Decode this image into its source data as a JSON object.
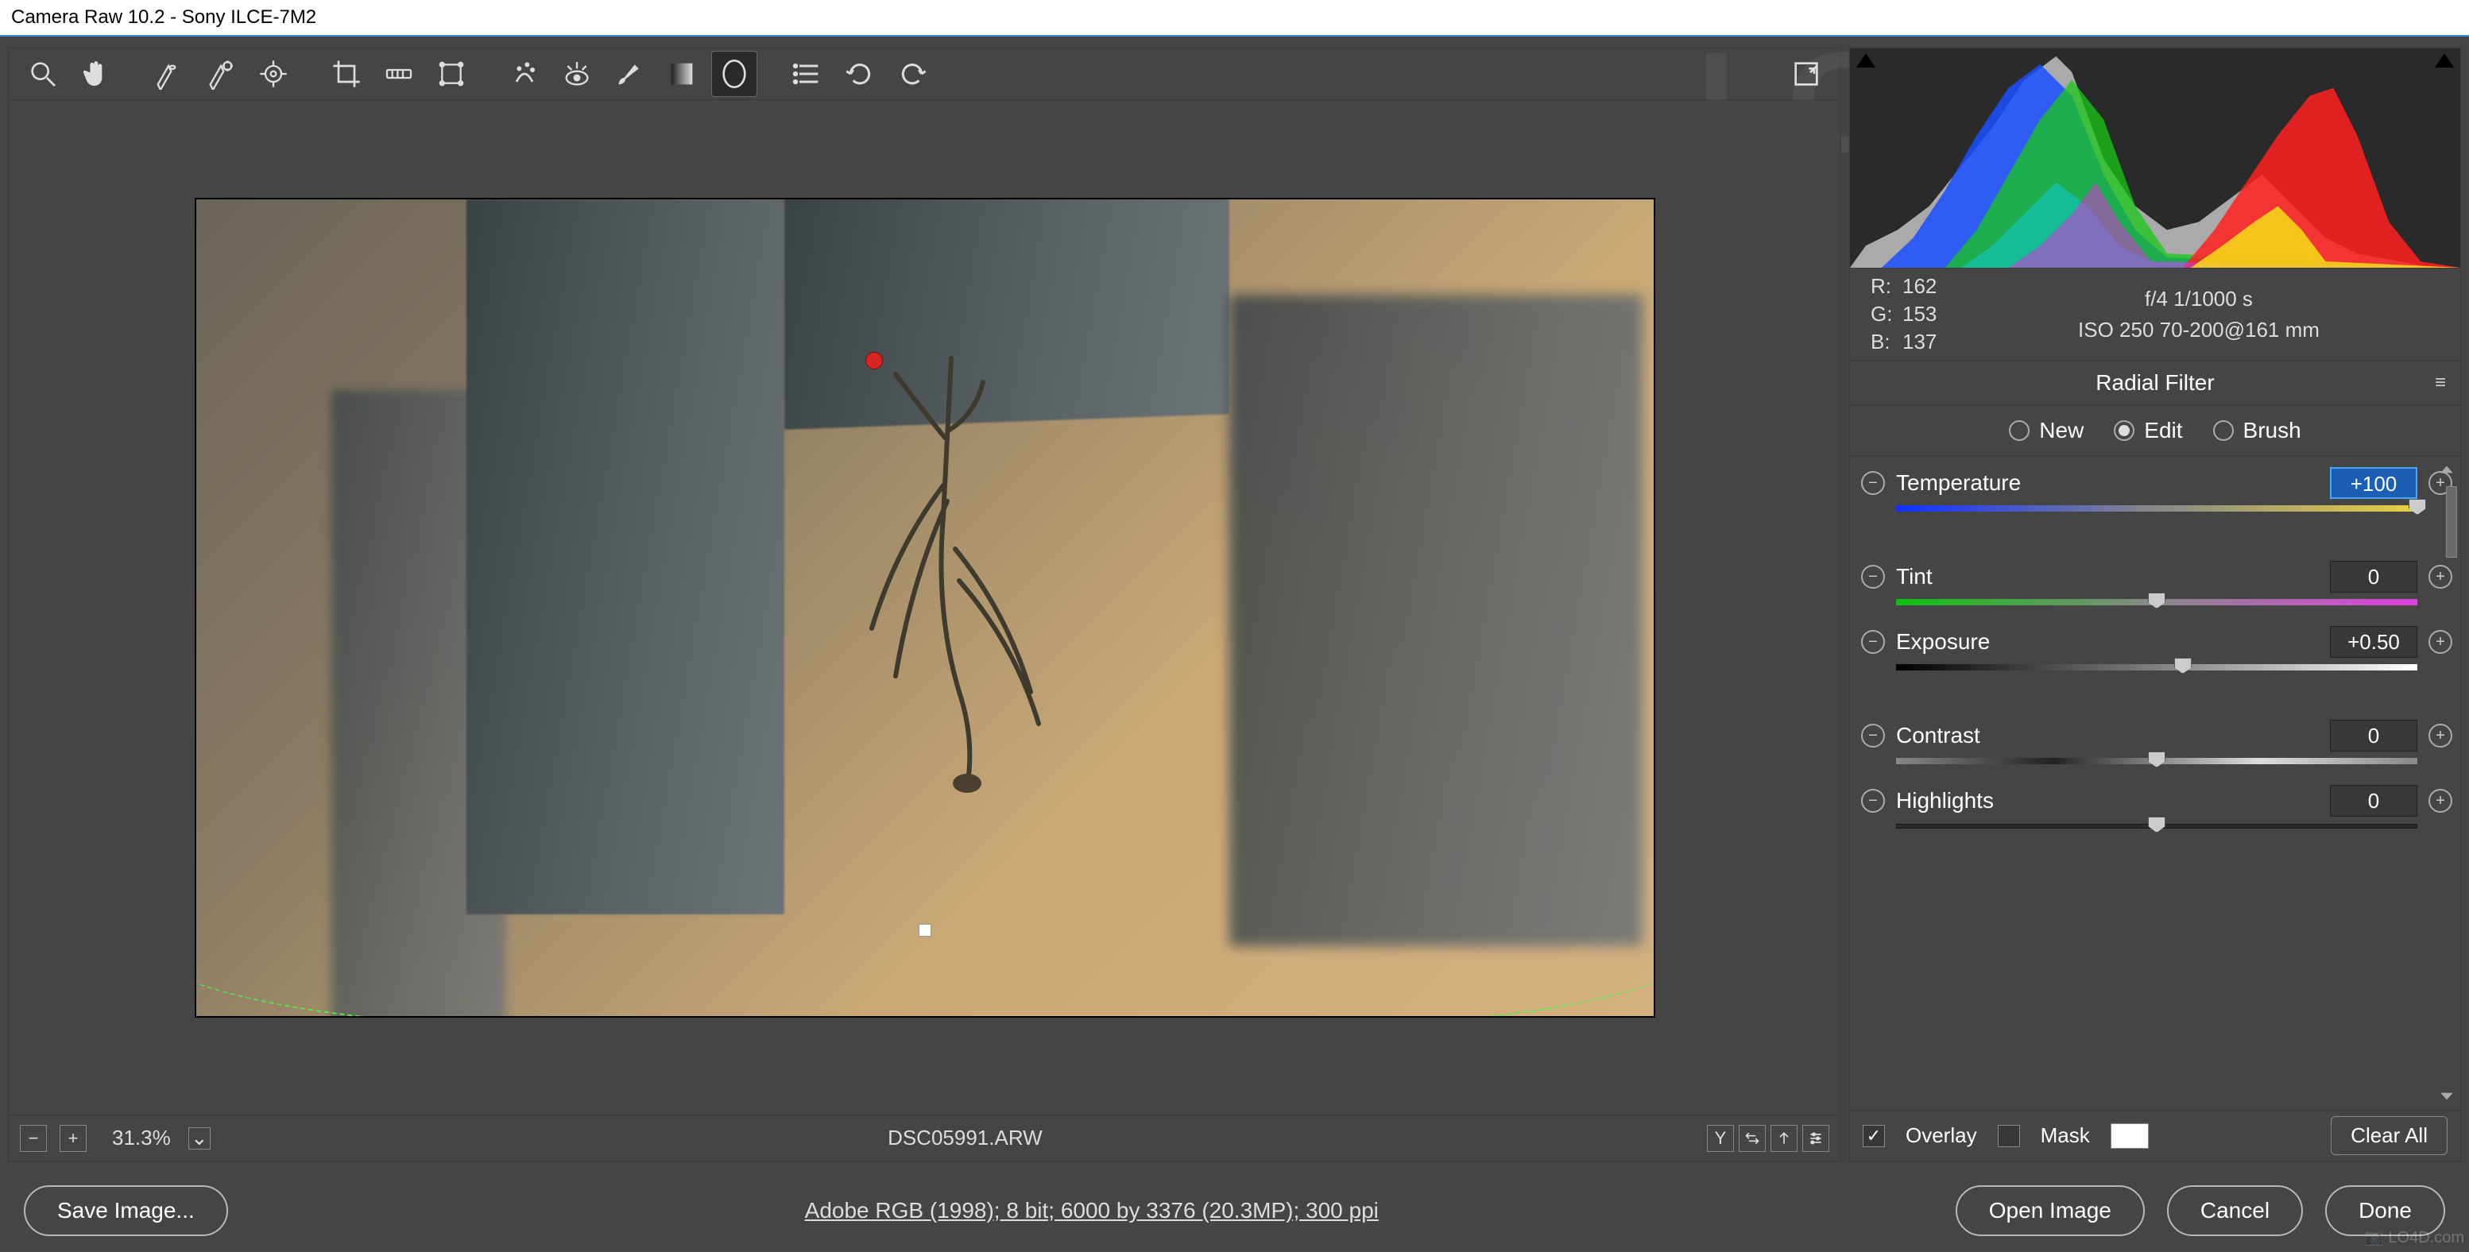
{
  "title": "Camera Raw 10.2  -  Sony ILCE-7M2",
  "toolbar": {
    "tools": [
      "zoom",
      "hand",
      "white-balance",
      "color-sampler",
      "target-adjust",
      "crop",
      "straighten",
      "transform",
      "spot-removal",
      "red-eye",
      "brush",
      "gradient",
      "radial",
      "options",
      "rotate-ccw",
      "rotate-cw"
    ],
    "active": "radial",
    "fullscreen": "fullscreen"
  },
  "preview": {
    "filename": "DSC05991.ARW",
    "zoom": "31.3%"
  },
  "rgb": {
    "r": "162",
    "g": "153",
    "b": "137",
    "rl": "R:",
    "gl": "G:",
    "bl": "B:"
  },
  "exif": {
    "line1": "f/4   1/1000 s",
    "line2": "ISO 250   70-200@161 mm"
  },
  "panel": {
    "title": "Radial Filter",
    "modes": {
      "new": "New",
      "edit": "Edit",
      "brush": "Brush",
      "selected": "edit"
    }
  },
  "sliders": [
    {
      "name": "temperature",
      "label": "Temperature",
      "value": "+100",
      "pos": 100,
      "grad": "temp",
      "hl": true
    },
    {
      "name": "tint",
      "label": "Tint",
      "value": "0",
      "pos": 50,
      "grad": "tint"
    },
    {
      "name": "exposure",
      "label": "Exposure",
      "value": "+0.50",
      "pos": 55,
      "grad": "exp"
    },
    {
      "name": "contrast",
      "label": "Contrast",
      "value": "0",
      "pos": 50,
      "grad": "con"
    },
    {
      "name": "highlights",
      "label": "Highlights",
      "value": "0",
      "pos": 50,
      "grad": "bar"
    }
  ],
  "opts": {
    "overlay": "Overlay",
    "mask": "Mask",
    "clear": "Clear All"
  },
  "footer": {
    "save": "Save Image...",
    "link": "Adobe RGB (1998); 8 bit; 6000 by 3376 (20.3MP); 300 ppi",
    "open": "Open Image",
    "cancel": "Cancel",
    "done": "Done"
  },
  "watermark": "LO4D.com"
}
